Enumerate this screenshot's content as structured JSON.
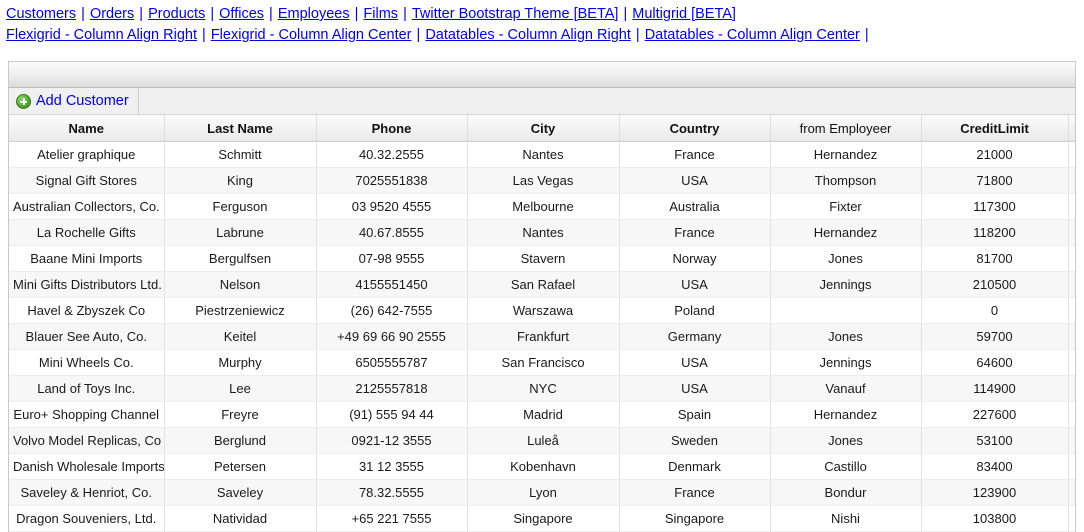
{
  "nav": {
    "line1": [
      {
        "label": "Customers"
      },
      {
        "label": "Orders"
      },
      {
        "label": "Products"
      },
      {
        "label": "Offices"
      },
      {
        "label": "Employees"
      },
      {
        "label": "Films"
      },
      {
        "label": "Twitter Bootstrap Theme [BETA]"
      },
      {
        "label": "Multigrid [BETA]"
      }
    ],
    "line2": [
      {
        "label": "Flexigrid - Column Align Right"
      },
      {
        "label": "Flexigrid - Column Align Center"
      },
      {
        "label": "Datatables - Column Align Right"
      },
      {
        "label": "Datatables - Column Align Center"
      }
    ],
    "separator": "|",
    "link_color": "#0000ee"
  },
  "grid": {
    "toolbar": {
      "add_customer_label": "Add Customer",
      "add_customer_icon": "plus-circle-icon"
    },
    "columns": [
      {
        "key": "name",
        "label": "Name",
        "bold": true
      },
      {
        "key": "last_name",
        "label": "Last Name",
        "bold": true
      },
      {
        "key": "phone",
        "label": "Phone",
        "bold": true
      },
      {
        "key": "city",
        "label": "City",
        "bold": true
      },
      {
        "key": "country",
        "label": "Country",
        "bold": true
      },
      {
        "key": "employeer",
        "label": "from Employeer",
        "bold": false
      },
      {
        "key": "credit_limit",
        "label": "CreditLimit",
        "bold": true
      },
      {
        "key": "spacer",
        "label": "",
        "bold": false
      }
    ],
    "rows": [
      {
        "name": "Atelier graphique",
        "last_name": "Schmitt",
        "phone": "40.32.2555",
        "city": "Nantes",
        "country": "France",
        "employeer": "Hernandez",
        "credit_limit": "21000"
      },
      {
        "name": "Signal Gift Stores",
        "last_name": "King",
        "phone": "7025551838",
        "city": "Las Vegas",
        "country": "USA",
        "employeer": "Thompson",
        "credit_limit": "71800"
      },
      {
        "name": "Australian Collectors, Co.",
        "last_name": "Ferguson",
        "phone": "03 9520 4555",
        "city": "Melbourne",
        "country": "Australia",
        "employeer": "Fixter",
        "credit_limit": "117300"
      },
      {
        "name": "La Rochelle Gifts",
        "last_name": "Labrune",
        "phone": "40.67.8555",
        "city": "Nantes",
        "country": "France",
        "employeer": "Hernandez",
        "credit_limit": "118200"
      },
      {
        "name": "Baane Mini Imports",
        "last_name": "Bergulfsen",
        "phone": "07-98 9555",
        "city": "Stavern",
        "country": "Norway",
        "employeer": "Jones",
        "credit_limit": "81700"
      },
      {
        "name": "Mini Gifts Distributors Ltd.",
        "last_name": "Nelson",
        "phone": "4155551450",
        "city": "San Rafael",
        "country": "USA",
        "employeer": "Jennings",
        "credit_limit": "210500"
      },
      {
        "name": "Havel & Zbyszek Co",
        "last_name": "Piestrzeniewicz",
        "phone": "(26) 642-7555",
        "city": "Warszawa",
        "country": "Poland",
        "employeer": "",
        "credit_limit": "0"
      },
      {
        "name": "Blauer See Auto, Co.",
        "last_name": "Keitel",
        "phone": "+49 69 66 90 2555",
        "city": "Frankfurt",
        "country": "Germany",
        "employeer": "Jones",
        "credit_limit": "59700"
      },
      {
        "name": "Mini Wheels Co.",
        "last_name": "Murphy",
        "phone": "6505555787",
        "city": "San Francisco",
        "country": "USA",
        "employeer": "Jennings",
        "credit_limit": "64600"
      },
      {
        "name": "Land of Toys Inc.",
        "last_name": "Lee",
        "phone": "2125557818",
        "city": "NYC",
        "country": "USA",
        "employeer": "Vanauf",
        "credit_limit": "114900"
      },
      {
        "name": "Euro+ Shopping Channel",
        "last_name": "Freyre",
        "phone": "(91) 555 94 44",
        "city": "Madrid",
        "country": "Spain",
        "employeer": "Hernandez",
        "credit_limit": "227600"
      },
      {
        "name": "Volvo Model Replicas, Co",
        "last_name": "Berglund",
        "phone": "0921-12 3555",
        "city": "Luleå",
        "country": "Sweden",
        "employeer": "Jones",
        "credit_limit": "53100"
      },
      {
        "name": "Danish Wholesale Imports",
        "last_name": "Petersen",
        "phone": "31 12 3555",
        "city": "Kobenhavn",
        "country": "Denmark",
        "employeer": "Castillo",
        "credit_limit": "83400"
      },
      {
        "name": "Saveley & Henriot, Co.",
        "last_name": "Saveley",
        "phone": "78.32.5555",
        "city": "Lyon",
        "country": "France",
        "employeer": "Bondur",
        "credit_limit": "123900"
      },
      {
        "name": "Dragon Souveniers, Ltd.",
        "last_name": "Natividad",
        "phone": "+65 221 7555",
        "city": "Singapore",
        "country": "Singapore",
        "employeer": "Nishi",
        "credit_limit": "103800"
      }
    ]
  }
}
